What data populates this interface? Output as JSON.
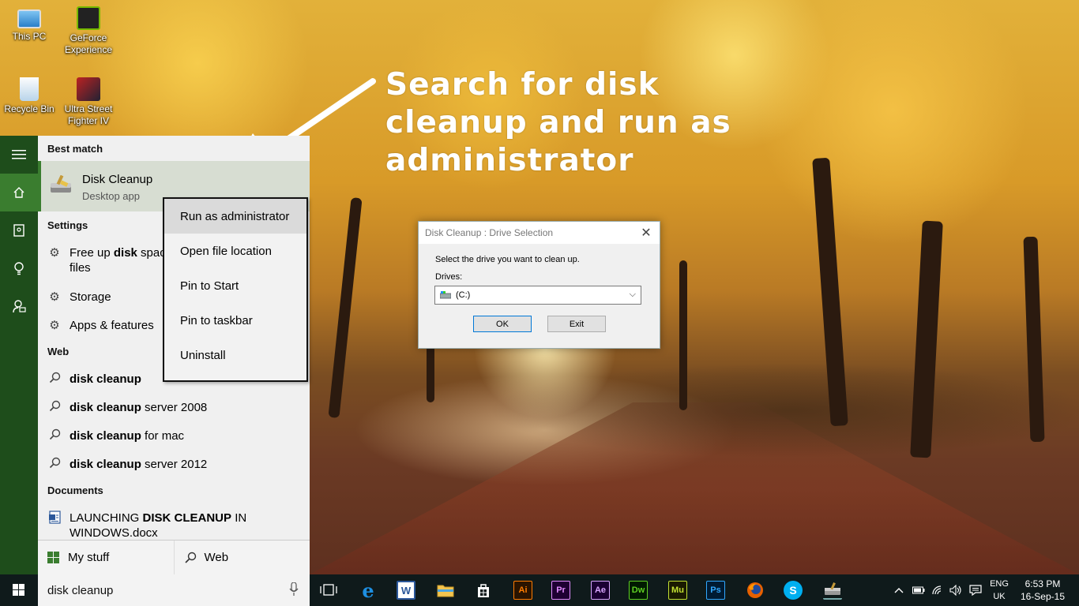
{
  "desktop": {
    "icons": [
      {
        "label": "This PC",
        "icon": "computer-icon"
      },
      {
        "label": "GeForce Experience",
        "icon": "nvidia-icon"
      },
      {
        "label": "Recycle Bin",
        "icon": "recycle-bin-icon"
      },
      {
        "label": "Ultra Street Fighter IV",
        "icon": "game-icon"
      }
    ]
  },
  "annotation": {
    "text": "Search for disk cleanup and run as administrator"
  },
  "start_menu": {
    "rail_icons": [
      "hamburger-menu-icon",
      "home-icon",
      "notebook-icon",
      "lightbulb-icon",
      "feedback-icon"
    ],
    "best_match": {
      "heading": "Best match",
      "title": "Disk Cleanup",
      "subtitle": "Desktop app"
    },
    "settings": {
      "heading": "Settings",
      "items": [
        {
          "pre": "Free up ",
          "bold": "disk",
          "post": " space",
          "line2": "files"
        },
        {
          "label": "Storage"
        },
        {
          "label": "Apps & features"
        }
      ]
    },
    "web": {
      "heading": "Web",
      "items": [
        {
          "bold": "disk cleanup",
          "post": ""
        },
        {
          "bold": "disk cleanup",
          "post": " server 2008"
        },
        {
          "bold": "disk cleanup",
          "post": " for mac"
        },
        {
          "bold": "disk cleanup",
          "post": " server 2012"
        }
      ]
    },
    "documents": {
      "heading": "Documents",
      "items": [
        {
          "pre": "LAUNCHING ",
          "bold": "DISK CLEANUP",
          "post": " IN",
          "line2": "WINDOWS.docx"
        }
      ]
    },
    "context_menu": [
      "Run as administrator",
      "Open file location",
      "Pin to Start",
      "Pin to taskbar",
      "Uninstall"
    ],
    "bottom_tabs": [
      {
        "label": "My stuff",
        "icon": "windows-logo-icon"
      },
      {
        "label": "Web",
        "icon": "search-icon"
      }
    ]
  },
  "dialog": {
    "title": "Disk Cleanup : Drive Selection",
    "prompt": "Select the drive you want to clean up.",
    "drives_label": "Drives:",
    "selected_drive": "(C:)",
    "ok_label": "OK",
    "exit_label": "Exit"
  },
  "taskbar": {
    "search_text": "disk cleanup",
    "apps": [
      {
        "icon": "task-view-icon",
        "text": ""
      },
      {
        "icon": "edge-icon",
        "text": "e"
      },
      {
        "icon": "word-icon",
        "text": "W"
      },
      {
        "icon": "file-explorer-icon",
        "text": ""
      },
      {
        "icon": "store-icon",
        "text": ""
      },
      {
        "icon": "illustrator-icon",
        "text": "Ai"
      },
      {
        "icon": "premiere-icon",
        "text": "Pr"
      },
      {
        "icon": "after-effects-icon",
        "text": "Ae"
      },
      {
        "icon": "dreamweaver-icon",
        "text": "Dw"
      },
      {
        "icon": "muse-icon",
        "text": "Mu"
      },
      {
        "icon": "photoshop-icon",
        "text": "Ps"
      },
      {
        "icon": "firefox-icon",
        "text": ""
      },
      {
        "icon": "skype-icon",
        "text": "S"
      },
      {
        "icon": "disk-cleanup-icon",
        "text": ""
      }
    ],
    "language": {
      "top": "ENG",
      "bottom": "UK"
    },
    "time": "6:53 PM",
    "date": "16-Sep-15"
  },
  "colors": {
    "start_accent": "#3a7d2f",
    "rail_bg": "#1e4d1b",
    "taskbar_bg": "#0f1a1b"
  }
}
